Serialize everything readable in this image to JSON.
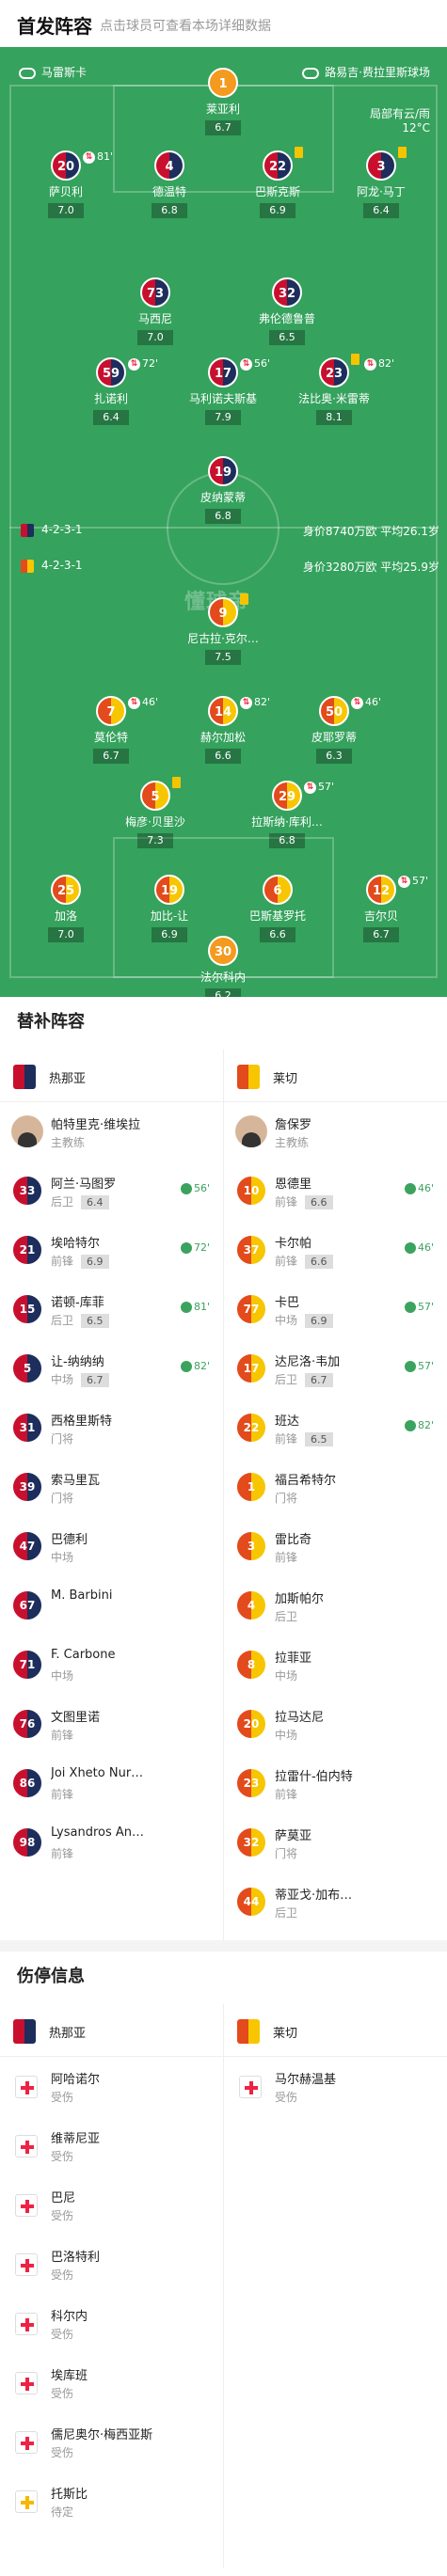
{
  "header": {
    "title": "首发阵容",
    "hint": "点击球员可查看本场详细数据"
  },
  "meta": {
    "referee": "马雷斯卡",
    "venue": "路易吉·费拉里斯球场",
    "weather": "局部有云/雨",
    "temp": "12°C"
  },
  "watermark": "懂球帝",
  "home_formation": "4-2-3-1",
  "away_formation": "4-2-3-1",
  "home_value": "身价8740万欧 平均26.1岁",
  "away_value": "身价3280万欧 平均25.9岁",
  "home_players": [
    {
      "num": "1",
      "name": "莱亚利",
      "rating": "6.7",
      "gk": true
    },
    {
      "num": "20",
      "name": "萨贝利",
      "rating": "7.0",
      "sub": "81'"
    },
    {
      "num": "4",
      "name": "德温特",
      "rating": "6.8"
    },
    {
      "num": "22",
      "name": "巴斯克斯",
      "rating": "6.9",
      "yc": true
    },
    {
      "num": "3",
      "name": "阿龙·马丁",
      "rating": "6.4",
      "yc": true
    },
    {
      "num": "73",
      "name": "马西尼",
      "rating": "7.0"
    },
    {
      "num": "32",
      "name": "弗伦德鲁普",
      "rating": "6.5",
      "cap": "C"
    },
    {
      "num": "59",
      "name": "扎诺利",
      "rating": "6.4",
      "sub": "72'"
    },
    {
      "num": "17",
      "name": "马利诺夫斯基",
      "rating": "7.9",
      "sub": "56'"
    },
    {
      "num": "23",
      "name": "法比奥·米雷蒂",
      "rating": "8.1",
      "sub": "82'",
      "yc": true
    },
    {
      "num": "19",
      "name": "皮纳蒙蒂",
      "rating": "6.8"
    }
  ],
  "away_players": [
    {
      "num": "9",
      "name": "尼古拉·克尔…",
      "rating": "7.5",
      "yc": true
    },
    {
      "num": "7",
      "name": "莫伦特",
      "rating": "6.7",
      "sub": "46'"
    },
    {
      "num": "14",
      "name": "赫尔加松",
      "rating": "6.6",
      "sub": "82'"
    },
    {
      "num": "50",
      "name": "皮耶罗蒂",
      "rating": "6.3",
      "sub": "46'"
    },
    {
      "num": "5",
      "name": "梅彦·贝里沙",
      "rating": "7.3",
      "yc": true
    },
    {
      "num": "29",
      "name": "拉斯纳·库利…",
      "rating": "6.8",
      "sub": "57'"
    },
    {
      "num": "25",
      "name": "加洛",
      "rating": "7.0"
    },
    {
      "num": "19",
      "name": "加比-让",
      "rating": "6.9"
    },
    {
      "num": "6",
      "name": "巴斯基罗托",
      "rating": "6.6",
      "cap": "C"
    },
    {
      "num": "12",
      "name": "吉尔贝",
      "rating": "6.7",
      "sub": "57'"
    },
    {
      "num": "30",
      "name": "法尔科内",
      "rating": "6.2",
      "gk": true
    }
  ],
  "subs_title": "替补阵容",
  "home_team": "热那亚",
  "away_team": "莱切",
  "home_coach": {
    "name": "帕特里克·维埃拉",
    "role": "主教练"
  },
  "away_coach": {
    "name": "詹保罗",
    "role": "主教练"
  },
  "home_subs": [
    {
      "num": "33",
      "name": "阿兰·马图罗",
      "pos": "后卫",
      "rating": "6.4",
      "in": "56'"
    },
    {
      "num": "21",
      "name": "埃哈特尔",
      "pos": "前锋",
      "rating": "6.9",
      "in": "72'"
    },
    {
      "num": "15",
      "name": "诺顿-库菲",
      "pos": "后卫",
      "rating": "6.5",
      "in": "81'"
    },
    {
      "num": "5",
      "name": "让-纳纳纳",
      "pos": "中场",
      "rating": "6.7",
      "in": "82'"
    },
    {
      "num": "31",
      "name": "西格里斯特",
      "pos": "门将"
    },
    {
      "num": "39",
      "name": "索马里瓦",
      "pos": "门将"
    },
    {
      "num": "47",
      "name": "巴德利",
      "pos": "中场"
    },
    {
      "num": "67",
      "name": "M. Barbini",
      "pos": ""
    },
    {
      "num": "71",
      "name": "F. Carbone",
      "pos": "中场"
    },
    {
      "num": "76",
      "name": "文图里诺",
      "pos": "前锋"
    },
    {
      "num": "86",
      "name": "Joi Xheto Nur…",
      "pos": "前锋"
    },
    {
      "num": "98",
      "name": "Lysandros An…",
      "pos": "前锋"
    }
  ],
  "away_subs": [
    {
      "num": "10",
      "name": "恩德里",
      "pos": "前锋",
      "rating": "6.6",
      "in": "46'"
    },
    {
      "num": "37",
      "name": "卡尔帕",
      "pos": "前锋",
      "rating": "6.6",
      "in": "46'"
    },
    {
      "num": "77",
      "name": "卡巴",
      "pos": "中场",
      "rating": "6.9",
      "in": "57'"
    },
    {
      "num": "17",
      "name": "达尼洛·韦加",
      "pos": "后卫",
      "rating": "6.7",
      "in": "57'"
    },
    {
      "num": "22",
      "name": "班达",
      "pos": "前锋",
      "rating": "6.5",
      "in": "82'"
    },
    {
      "num": "1",
      "name": "福吕希特尔",
      "pos": "门将"
    },
    {
      "num": "3",
      "name": "雷比奇",
      "pos": "前锋"
    },
    {
      "num": "4",
      "name": "加斯帕尔",
      "pos": "后卫"
    },
    {
      "num": "8",
      "name": "拉菲亚",
      "pos": "中场"
    },
    {
      "num": "20",
      "name": "拉马达尼",
      "pos": "中场"
    },
    {
      "num": "23",
      "name": "拉雷什-伯内特",
      "pos": "前锋"
    },
    {
      "num": "32",
      "name": "萨莫亚",
      "pos": "门将"
    },
    {
      "num": "44",
      "name": "蒂亚戈·加布…",
      "pos": "后卫"
    }
  ],
  "inj_title": "伤停信息",
  "home_inj": [
    {
      "name": "阿哈诺尔",
      "status": "受伤"
    },
    {
      "name": "维蒂尼亚",
      "status": "受伤"
    },
    {
      "name": "巴尼",
      "status": "受伤"
    },
    {
      "name": "巴洛特利",
      "status": "受伤"
    },
    {
      "name": "科尔内",
      "status": "受伤"
    },
    {
      "name": "埃库班",
      "status": "受伤"
    },
    {
      "name": "儒尼奥尔·梅西亚斯",
      "status": "受伤"
    },
    {
      "name": "托斯比",
      "status": "待定",
      "pending": true
    }
  ],
  "away_inj": [
    {
      "name": "马尔赫温基",
      "status": "受伤"
    }
  ]
}
